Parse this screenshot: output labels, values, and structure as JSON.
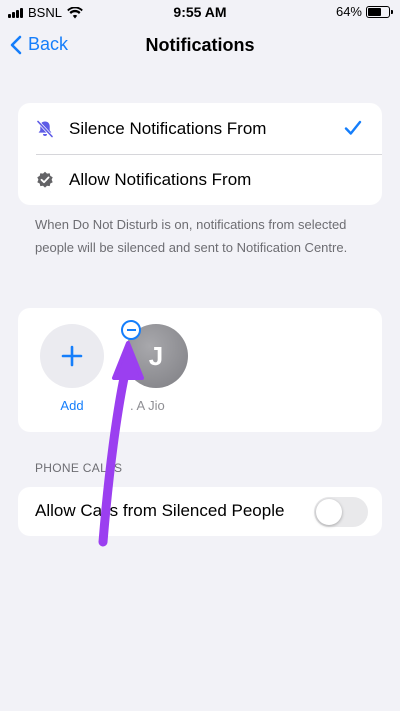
{
  "status_bar": {
    "carrier": "BSNL",
    "time": "9:55 AM",
    "battery_percent": "64%",
    "battery_level": 0.64
  },
  "nav": {
    "back_label": "Back",
    "title": "Notifications"
  },
  "options": [
    {
      "label": "Silence Notifications From",
      "icon": "bell-slash-icon",
      "selected": true
    },
    {
      "label": "Allow Notifications From",
      "icon": "checkmark-seal-icon",
      "selected": false
    }
  ],
  "helper_text": "When Do Not Disturb is on, notifications from selected people will be silenced and sent to Notification Centre.",
  "people": {
    "add_label": "Add",
    "contacts": [
      {
        "initial": "J",
        "name": ". A Jio"
      }
    ]
  },
  "phone_calls": {
    "section_header": "PHONE CALLS",
    "toggle_label": "Allow Calls from Silenced People",
    "toggle_on": false
  },
  "colors": {
    "accent": "#157efb",
    "background": "#f2f2f7",
    "annotation_arrow": "#9b3ff0",
    "icon_purple": "#5e5ce6",
    "icon_gray": "#636366"
  }
}
